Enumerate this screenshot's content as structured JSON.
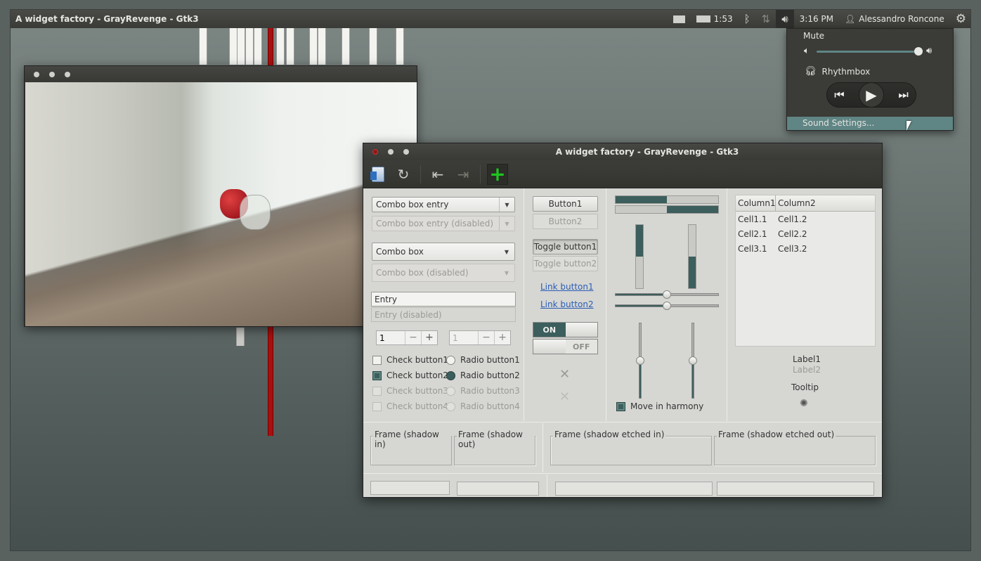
{
  "panel": {
    "title": "A widget factory - GrayRevenge - Gtk3",
    "battery_time": "1:53",
    "clock": "3:16 PM",
    "user": "Alessandro Roncone"
  },
  "sound_menu": {
    "mute_label": "Mute",
    "volume_level": 0.98,
    "player_name": "Rhythmbox",
    "settings_label": "Sound Settings..."
  },
  "widget_factory": {
    "window_title": "A widget factory - GrayRevenge - Gtk3",
    "col1": {
      "combo_entry": "Combo box entry",
      "combo_entry_disabled": "Combo box entry (disabled)",
      "combo": "Combo box",
      "combo_disabled": "Combo box (disabled)",
      "entry": "Entry",
      "entry_disabled": "Entry (disabled)",
      "spin_value": "1",
      "spin_value_disabled": "1",
      "check1": "Check button1",
      "check2": "Check button2",
      "check3": "Check button3",
      "check4": "Check button4",
      "radio1": "Radio button1",
      "radio2": "Radio button2",
      "radio3": "Radio button3",
      "radio4": "Radio button4"
    },
    "col2": {
      "button1": "Button1",
      "button2": "Button2",
      "toggle1": "Toggle button1",
      "toggle2": "Toggle button2",
      "link1": "Link button1",
      "link2": "Link button2",
      "switch_on": "ON",
      "switch_off": "OFF"
    },
    "col3": {
      "progress_h1": 0.5,
      "progress_h2": 0.5,
      "progress_v1": 0.5,
      "progress_v2": 0.5,
      "scale_h1": 0.5,
      "scale_h2": 0.5,
      "scale_v1": 0.5,
      "scale_v2": 0.5,
      "move_in_harmony": "Move in harmony"
    },
    "col4": {
      "column1": "Column1",
      "column2": "Column2",
      "rows": [
        [
          "Cell1.1",
          "Cell1.2"
        ],
        [
          "Cell2.1",
          "Cell2.2"
        ],
        [
          "Cell3.1",
          "Cell3.2"
        ]
      ],
      "label1": "Label1",
      "label2": "Label2",
      "tooltip": "Tooltip"
    },
    "frames": {
      "shadow_in": "Frame (shadow in)",
      "shadow_out": "Frame (shadow out)",
      "etched_in": "Frame (shadow etched in)",
      "etched_out": "Frame (shadow etched out)"
    }
  },
  "colors": {
    "accent": "#3c5e5c",
    "menu_highlight": "#5f8584",
    "add_icon": "#1fc41f",
    "stripe_red": "#a80f0f"
  },
  "icons": [
    "mail-icon",
    "battery-icon",
    "bluetooth-icon",
    "network-icon",
    "volume-icon",
    "user-icon",
    "gear-icon",
    "headphones-icon",
    "previous-icon",
    "play-icon",
    "next-icon",
    "new-icon",
    "refresh-icon",
    "back-icon",
    "forward-icon",
    "add-icon",
    "close-icon",
    "spinner-icon"
  ]
}
